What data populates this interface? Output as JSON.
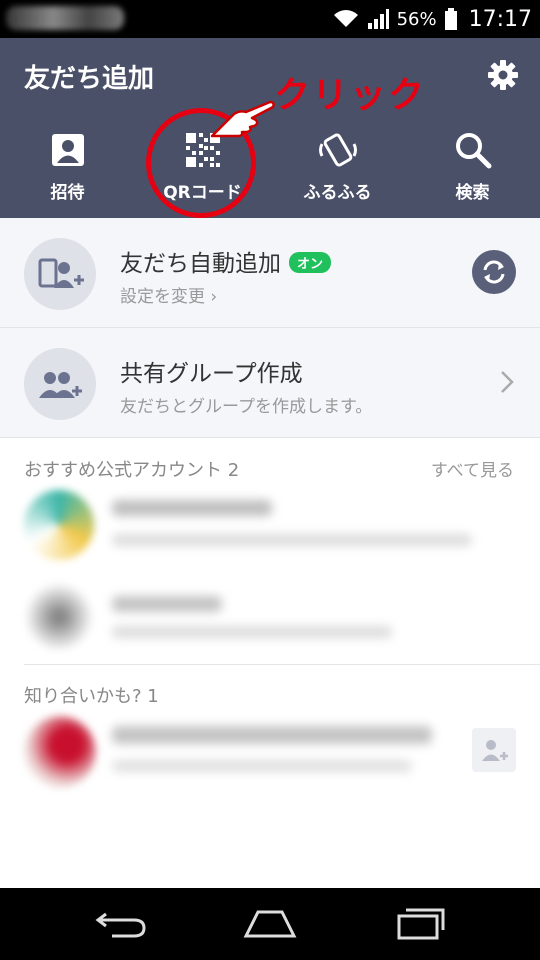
{
  "status_bar": {
    "battery": "56%",
    "time": "17:17"
  },
  "header": {
    "title": "友だち追加",
    "actions": [
      {
        "label": "招待",
        "icon": "contact-book-icon"
      },
      {
        "label": "QRコード",
        "icon": "qr-code-icon"
      },
      {
        "label": "ふるふる",
        "icon": "shake-phone-icon"
      },
      {
        "label": "検索",
        "icon": "search-icon"
      }
    ]
  },
  "annotation": {
    "text": "クリック",
    "color": "#e60012"
  },
  "auto_add": {
    "title": "友だち自動追加",
    "badge": "オン",
    "subtitle": "設定を変更 ›"
  },
  "group_create": {
    "title": "共有グループ作成",
    "subtitle": "友だちとグループを作成します。"
  },
  "recommended": {
    "heading": "おすすめ公式アカウント 2",
    "see_all": "すべて見る"
  },
  "maybe_know": {
    "heading": "知り合いかも? 1"
  },
  "colors": {
    "header_bg": "#4a5068",
    "badge_green": "#20c05c",
    "accent_red": "#e60012"
  }
}
